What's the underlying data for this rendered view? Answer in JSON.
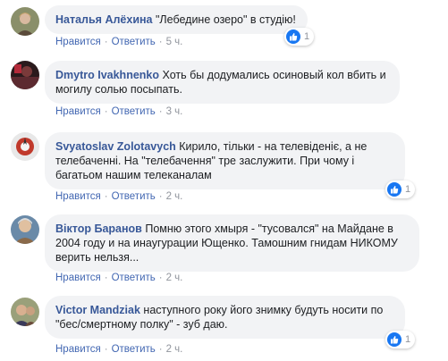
{
  "actions": {
    "like": "Нравится",
    "reply": "Ответить",
    "separator": "·"
  },
  "comments": [
    {
      "author": "Наталья Алёхина",
      "text": "\"Лебедине озеро\" в студію!",
      "time": "5 ч.",
      "likes": "1"
    },
    {
      "author": "Dmytro Ivakhnenko",
      "text": "Хоть бы додумались осиновый кол вбить и могилу солью посыпать.",
      "time": "3 ч."
    },
    {
      "author": "Svyatoslav Zolotavych",
      "text": "Кирило, тільки - на телевіденіє, а не телебаченні. На \"телебачення\" тре заслужити. При чому і багатьом нашим телеканалам",
      "time": "2 ч.",
      "likes": "1"
    },
    {
      "author": "Віктор Баранов",
      "text": "Помню этого хмыря - \"тусовался\" на Майдане в 2004 году и на инаугурации Ющенко. Тамошним гнидам НИКОМУ верить нельзя...",
      "time": "2 ч."
    },
    {
      "author": "Victor Mandziak",
      "text": "наступного року його знимку будуть носити по \"бес/смертному полку\" - зуб даю.",
      "time": "2 ч.",
      "likes": "1"
    }
  ],
  "colors": {
    "author": "#385898",
    "bubble": "#f2f3f5",
    "link": "#4267b2",
    "meta": "#90949c",
    "like": "#1877f2"
  },
  "icons": {
    "reaction": "like-thumb-icon"
  }
}
